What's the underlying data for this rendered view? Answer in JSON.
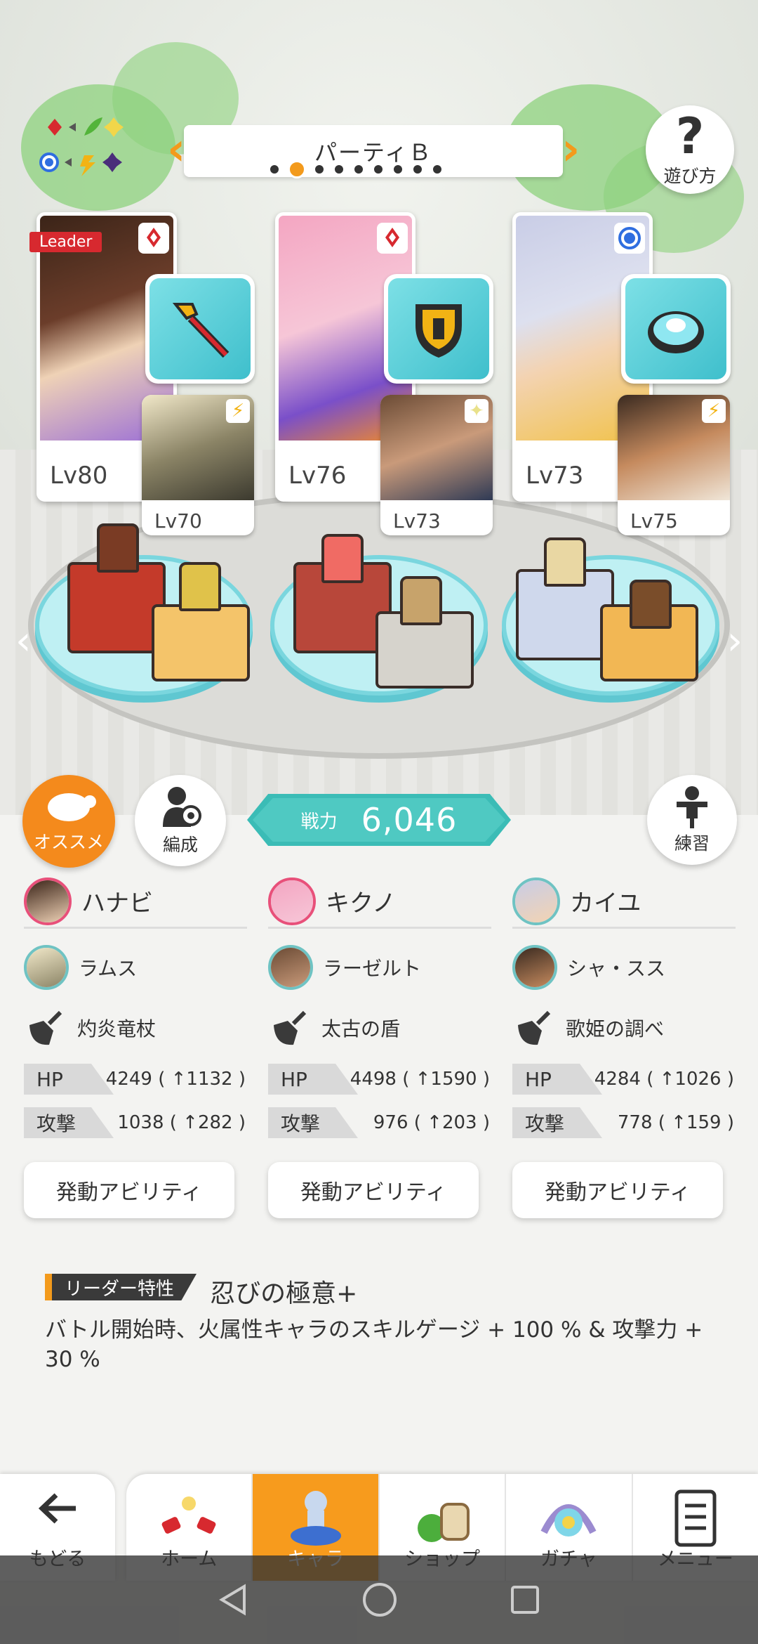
{
  "header": {
    "party_title": "パーティＢ",
    "page_dots": 9,
    "active_dot": 1,
    "help_label": "遊び方"
  },
  "team": [
    {
      "leader_label": "Leader",
      "main_level": "Lv80",
      "element": "fire",
      "sub_level": "Lv70",
      "sub_element": "thunder"
    },
    {
      "main_level": "Lv76",
      "element": "fire",
      "sub_level": "Lv73",
      "sub_element": "light"
    },
    {
      "main_level": "Lv73",
      "element": "water",
      "sub_level": "Lv75",
      "sub_element": "thunder"
    }
  ],
  "buttons": {
    "recommend_label": "オススメ",
    "formation_label": "編成",
    "practice_label": "練習"
  },
  "power": {
    "label": "戦力",
    "value": "6,046"
  },
  "members": [
    {
      "name": "ハナビ",
      "sub": "ラムス",
      "weapon": "灼炎竜杖",
      "hp_label": "HP",
      "hp": "4249 ( ↑1132 )",
      "atk_label": "攻撃",
      "atk": "1038 ( ↑282 )",
      "ability_label": "発動アビリティ"
    },
    {
      "name": "キクノ",
      "sub": "ラーゼルト",
      "weapon": "太古の盾",
      "hp_label": "HP",
      "hp": "4498 ( ↑1590 )",
      "atk_label": "攻撃",
      "atk": "976 ( ↑203 )",
      "ability_label": "発動アビリティ"
    },
    {
      "name": "カイユ",
      "sub": "シャ・スス",
      "weapon": "歌姫の調べ",
      "hp_label": "HP",
      "hp": "4284 ( ↑1026 )",
      "atk_label": "攻撃",
      "atk": "778 ( ↑159 )",
      "ability_label": "発動アビリティ"
    }
  ],
  "leader_skill": {
    "tag": "リーダー特性",
    "name": "忍びの極意+",
    "description": "バトル開始時、火属性キャラのスキルゲージ + 100 % & 攻撃力 + 30 %"
  },
  "nav": {
    "back": "もどる",
    "tabs": [
      "ホーム",
      "キャラ",
      "ショップ",
      "ガチャ",
      "メニュー"
    ],
    "active": "キャラ"
  },
  "colors": {
    "accent": "#f79b1d",
    "teal": "#3bbcb6",
    "fire": "#d7292f",
    "water": "#2f6ee0"
  }
}
